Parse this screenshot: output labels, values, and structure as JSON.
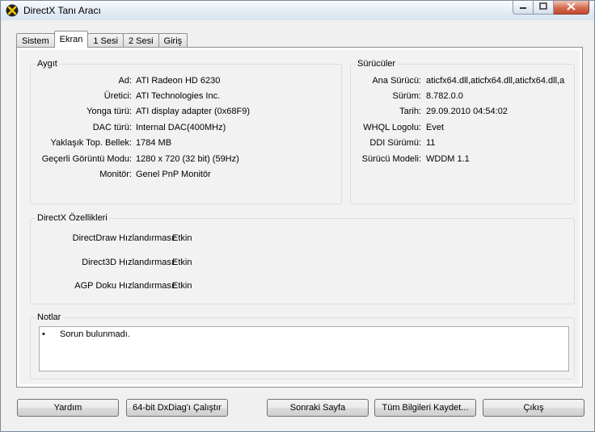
{
  "window": {
    "title": "DirectX Tanı Aracı"
  },
  "tabs": [
    "Sistem",
    "Ekran",
    "1 Sesi",
    "2 Sesi",
    "Giriş"
  ],
  "active_tab": "Ekran",
  "device": {
    "legend": "Aygıt",
    "rows": [
      {
        "label": "Ad:",
        "value": "ATI Radeon HD 6230"
      },
      {
        "label": "Üretici:",
        "value": "ATI Technologies Inc."
      },
      {
        "label": "Yonga türü:",
        "value": "ATI display adapter (0x68F9)"
      },
      {
        "label": "DAC türü:",
        "value": "Internal DAC(400MHz)"
      },
      {
        "label": "Yaklaşık Top. Bellek:",
        "value": "1784 MB"
      },
      {
        "label": "Geçerli Görüntü Modu:",
        "value": "1280 x 720 (32 bit) (59Hz)"
      },
      {
        "label": "Monitör:",
        "value": "Genel PnP Monitör"
      }
    ]
  },
  "drivers": {
    "legend": "Sürücüler",
    "rows": [
      {
        "label": "Ana Sürücü:",
        "value": "aticfx64.dll,aticfx64.dll,aticfx64.dll,a"
      },
      {
        "label": "Sürüm:",
        "value": "8.782.0.0"
      },
      {
        "label": "Tarih:",
        "value": "29.09.2010 04:54:02"
      },
      {
        "label": "WHQL Logolu:",
        "value": "Evet"
      },
      {
        "label": "DDI Sürümü:",
        "value": "11"
      },
      {
        "label": "Sürücü Modeli:",
        "value": "WDDM 1.1"
      }
    ]
  },
  "directx_features": {
    "legend": "DirectX Özellikleri",
    "rows": [
      {
        "label": "DirectDraw Hızlandırması:",
        "value": "Etkin"
      },
      {
        "label": "Direct3D Hızlandırması:",
        "value": "Etkin"
      },
      {
        "label": "AGP Doku Hızlandırması:",
        "value": "Etkin"
      }
    ]
  },
  "notes": {
    "legend": "Notlar",
    "items": [
      "Sorun bulunmadı."
    ]
  },
  "buttons": {
    "help": "Yardım",
    "run64": "64-bit DxDiag'ı Çalıştır",
    "next": "Sonraki Sayfa",
    "save_all": "Tüm Bilgileri Kaydet...",
    "exit": "Çıkış"
  },
  "icons": {
    "app": "directx-icon",
    "minimize": "minimize-icon",
    "maximize": "maximize-icon",
    "close": "close-icon"
  }
}
